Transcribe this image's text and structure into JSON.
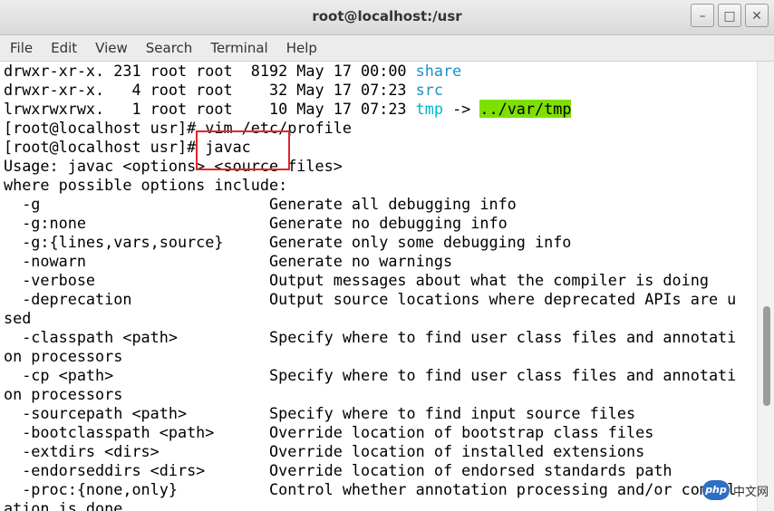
{
  "window": {
    "title": "root@localhost:/usr",
    "controls": {
      "minimize": "–",
      "maximize": "□",
      "close": "✕"
    }
  },
  "menubar": {
    "items": [
      "File",
      "Edit",
      "View",
      "Search",
      "Terminal",
      "Help"
    ]
  },
  "terminal": {
    "listing": [
      {
        "perm": "drwxr-xr-x. 231 root root  8192 May 17 00:00 ",
        "name": "share"
      },
      {
        "perm": "drwxr-xr-x.   4 root root    32 May 17 07:23 ",
        "name": "src"
      },
      {
        "perm": "lrwxrwxrwx.   1 root root    10 May 17 07:23 ",
        "name": "tmp",
        "arrow": " -> ",
        "target": "../var/tmp"
      }
    ],
    "lines": [
      "[root@localhost usr]# vim /etc/profile",
      "[root@localhost usr]# javac",
      "Usage: javac <options> <source files>",
      "where possible options include:",
      "  -g                         Generate all debugging info",
      "  -g:none                    Generate no debugging info",
      "  -g:{lines,vars,source}     Generate only some debugging info",
      "  -nowarn                    Generate no warnings",
      "  -verbose                   Output messages about what the compiler is doing",
      "  -deprecation               Output source locations where deprecated APIs are u",
      "sed",
      "  -classpath <path>          Specify where to find user class files and annotati",
      "on processors",
      "  -cp <path>                 Specify where to find user class files and annotati",
      "on processors",
      "  -sourcepath <path>         Specify where to find input source files",
      "  -bootclasspath <path>      Override location of bootstrap class files",
      "  -extdirs <dirs>            Override location of installed extensions",
      "  -endorseddirs <dirs>       Override location of endorsed standards path",
      "  -proc:{none,only}          Control whether annotation processing and/or compil",
      "ation is done."
    ]
  },
  "watermark": {
    "logo": "php",
    "text": "中文网"
  },
  "colors": {
    "dir": "#1e90c8",
    "symlink": "#00b7c7",
    "symlink_target_bg": "#7ee000",
    "highlight_box": "#e0262b"
  }
}
